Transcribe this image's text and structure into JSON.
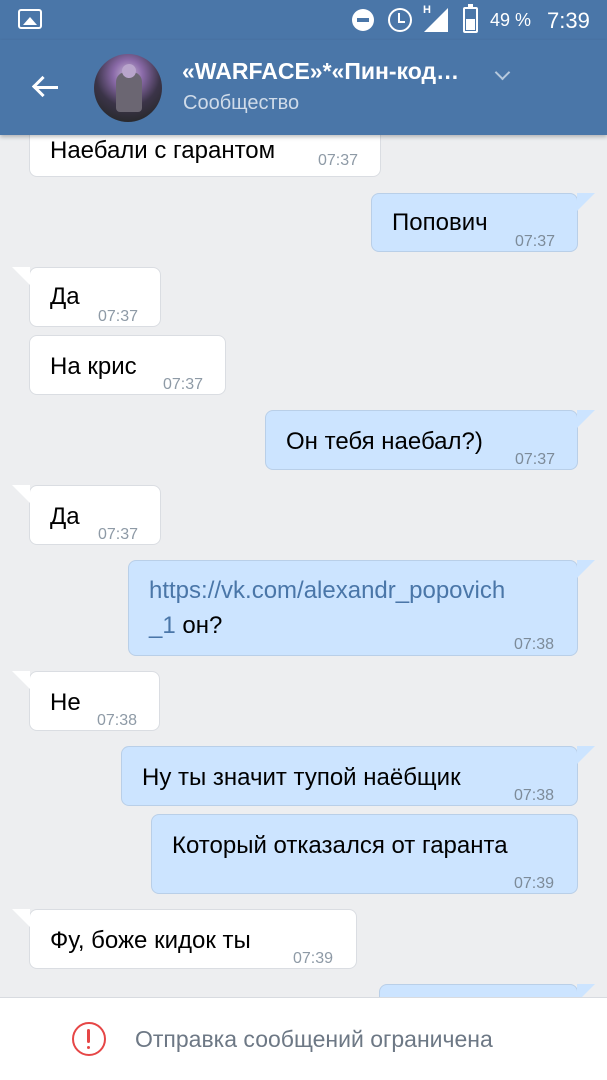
{
  "status_bar": {
    "network_label": "H",
    "battery": "49 %",
    "time": "7:39"
  },
  "header": {
    "title": "«WARFACE»*«Пин-код…",
    "subtitle": "Сообщество",
    "avatar_icon": "community-avatar"
  },
  "messages": [
    {
      "side": "in",
      "text": "Наебали с гарантом",
      "time": "07:37"
    },
    {
      "side": "out",
      "text": "Попович",
      "time": "07:37"
    },
    {
      "side": "in",
      "text": "Да",
      "time": "07:37"
    },
    {
      "side": "in",
      "text": "На крис",
      "time": "07:37"
    },
    {
      "side": "out",
      "text": "Он тебя наебал?)",
      "time": "07:37"
    },
    {
      "side": "in",
      "text": "Да",
      "time": "07:37"
    },
    {
      "side": "out",
      "link_line1": "https://vk.com/alexandr_popovich",
      "link_line2": "_1",
      "text_after": " он?",
      "time": "07:38"
    },
    {
      "side": "in",
      "text": "Не",
      "time": "07:38"
    },
    {
      "side": "out",
      "text": "Ну ты значит тупой наёбщик",
      "time": "07:38"
    },
    {
      "side": "out",
      "text": "Который отказался от гаранта",
      "time": "07:39"
    },
    {
      "side": "in",
      "text": "Фу, боже кидок ты",
      "time": "07:39"
    }
  ],
  "footer": {
    "restriction": "Отправка сообщений ограничена"
  },
  "colors": {
    "accent": "#4a76a8",
    "background": "#edeef0",
    "outgoing_bubble": "#cce4ff",
    "incoming_bubble": "#ffffff",
    "warning": "#e64646"
  }
}
